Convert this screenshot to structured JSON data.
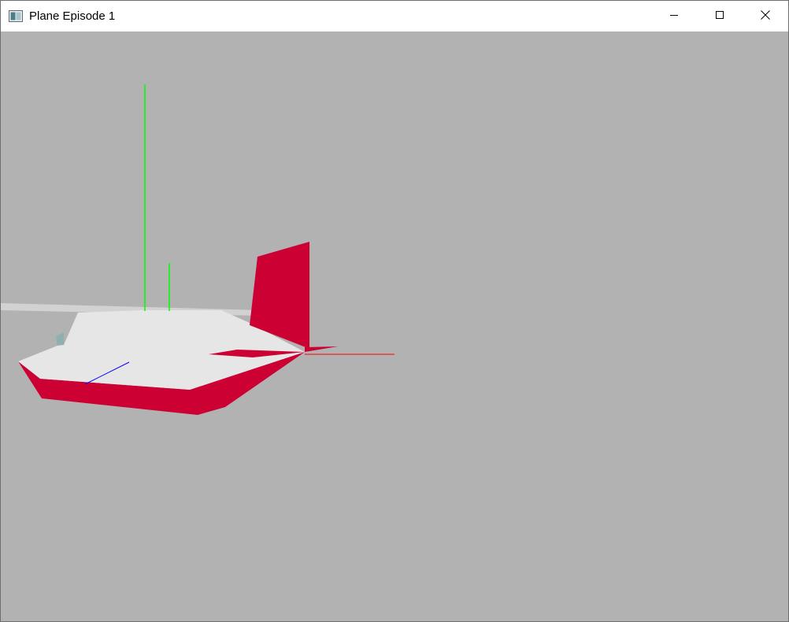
{
  "window": {
    "title": "Plane Episode 1",
    "icon": "app-window-icon",
    "controls": {
      "minimize_icon": "minimize-icon",
      "maximize_icon": "maximize-icon",
      "close_icon": "close-icon"
    }
  },
  "scene": {
    "background_color": "#b2b2b2",
    "plane": {
      "body_color": "#e6e6e6",
      "accent_color": "#cc0033"
    },
    "axes": {
      "x_color": "#ff0000",
      "y_color": "#00ff00",
      "z_color": "#0000ff"
    }
  }
}
